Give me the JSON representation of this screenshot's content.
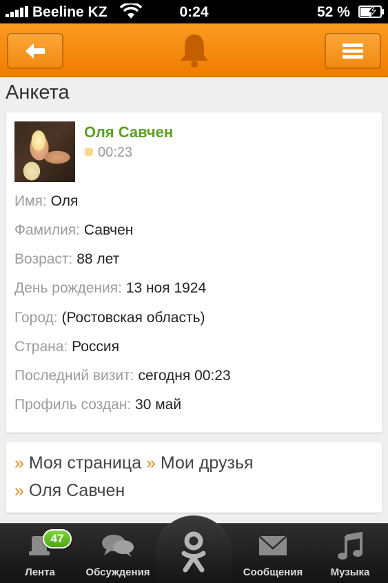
{
  "status_bar": {
    "carrier": "Beeline KZ",
    "time": "0:24",
    "battery_percent": "52 %"
  },
  "nav": {
    "back_icon": "arrow-left-icon",
    "center_icon": "bell-icon",
    "menu_icon": "hamburger-menu-icon"
  },
  "page": {
    "title": "Анкета"
  },
  "profile": {
    "name": "Оля Савчен",
    "last_online": "00:23",
    "fields": [
      {
        "label": "Имя:",
        "value": "Оля"
      },
      {
        "label": "Фамилия:",
        "value": "Савчен"
      },
      {
        "label": "Возраст:",
        "value": "88 лет"
      },
      {
        "label": "День рождения:",
        "value": "13 ноя 1924"
      },
      {
        "label": "Город:",
        "value": "(Ростовская область)"
      },
      {
        "label": "Страна:",
        "value": "Россия"
      },
      {
        "label": "Последний визит:",
        "value": "сегодня 00:23"
      },
      {
        "label": "Профиль создан:",
        "value": "30 май"
      }
    ]
  },
  "breadcrumb": {
    "separator": "»",
    "items": [
      "Моя страница",
      "Мои друзья",
      "Оля Савчен"
    ]
  },
  "tab_bar": {
    "tabs": [
      {
        "label": "Лента",
        "icon": "feed-icon",
        "badge": "47"
      },
      {
        "label": "Обсуждения",
        "icon": "discussions-icon"
      },
      {
        "label": "",
        "icon": "odnoklassniki-logo-icon"
      },
      {
        "label": "Сообщения",
        "icon": "envelope-icon"
      },
      {
        "label": "Музыка",
        "icon": "music-note-icon"
      }
    ]
  }
}
